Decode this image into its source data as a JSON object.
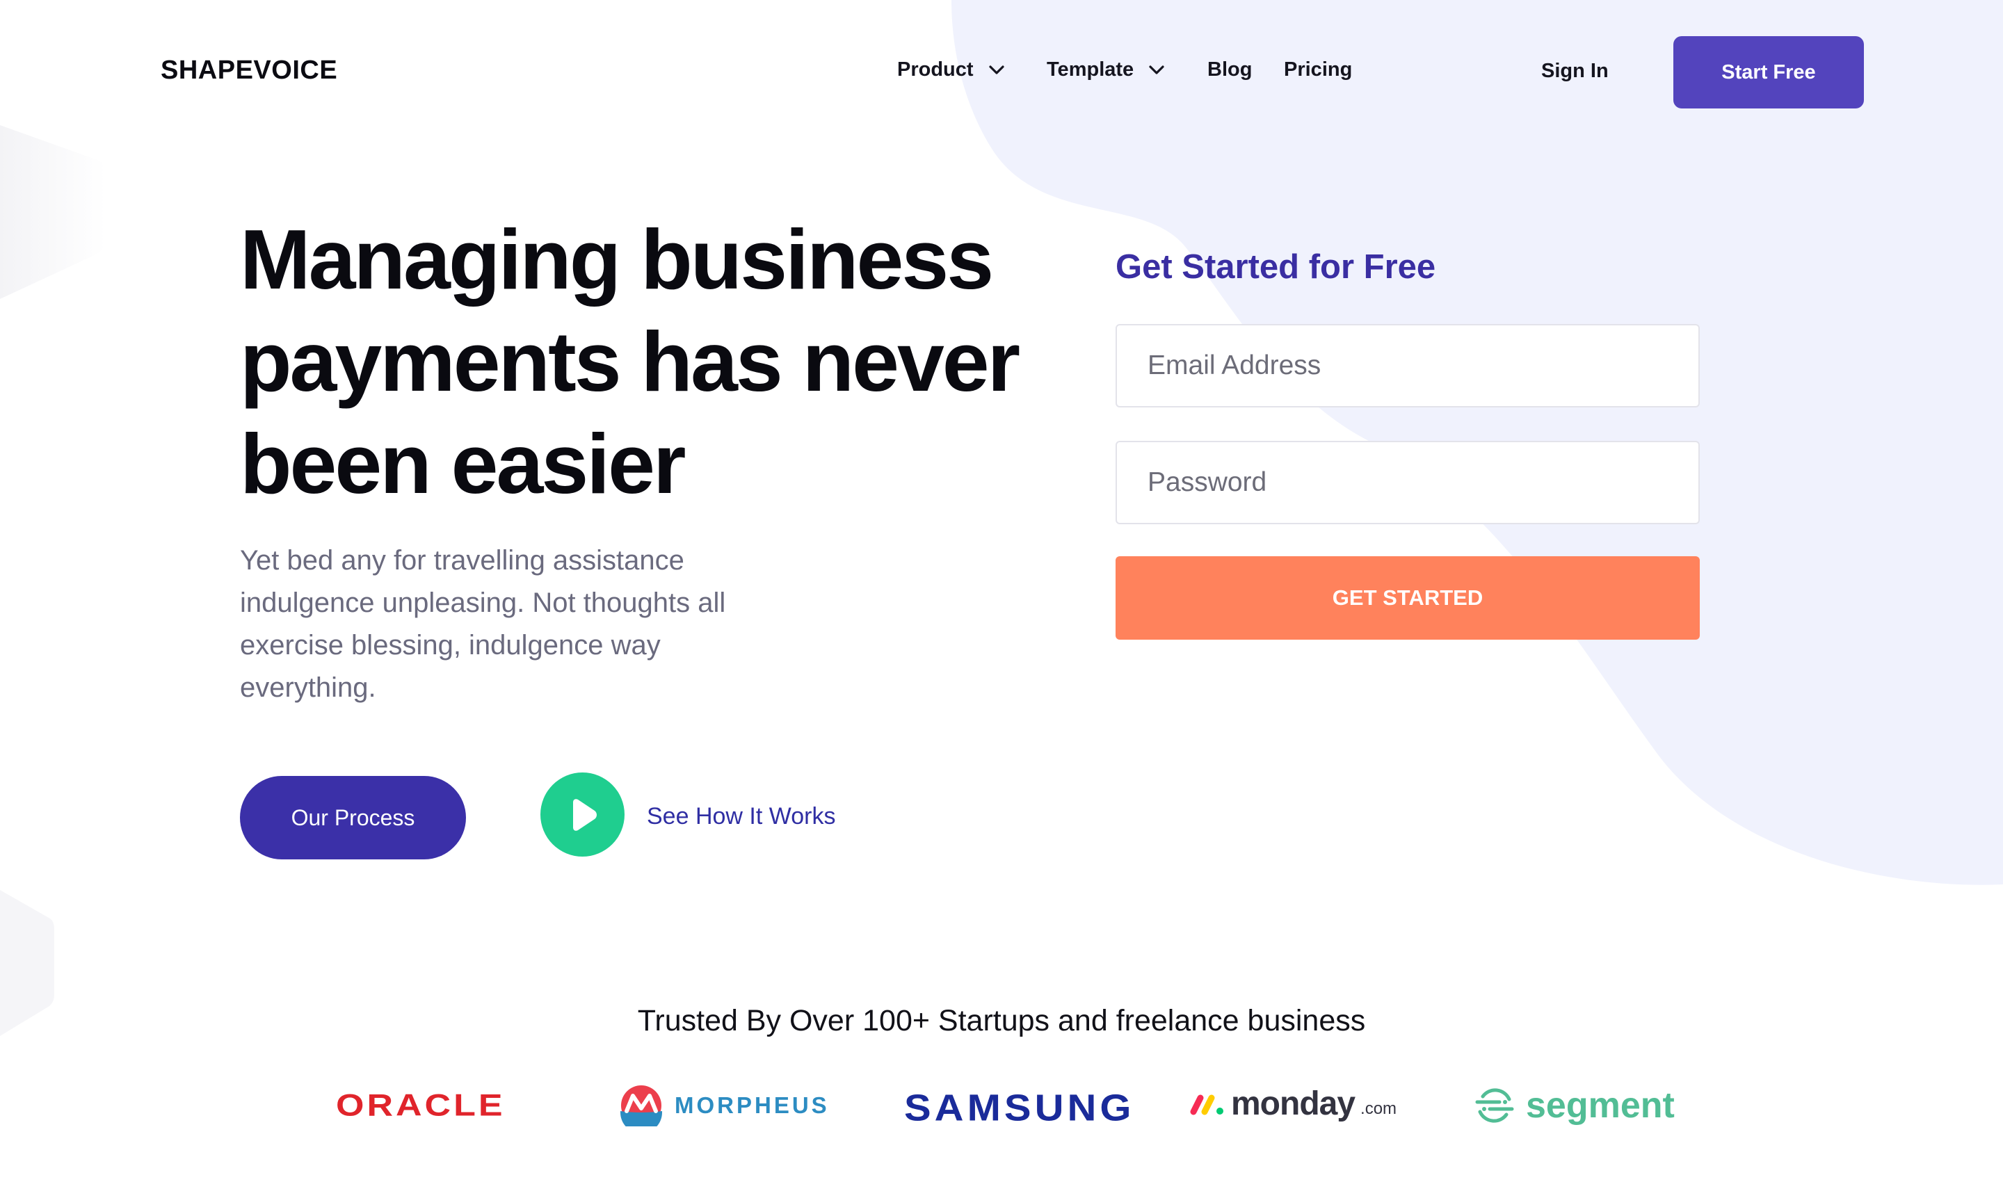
{
  "header": {
    "logo": "SHAPEVOICE",
    "nav": [
      {
        "label": "Product",
        "dropdown": true
      },
      {
        "label": "Template",
        "dropdown": true
      },
      {
        "label": "Blog",
        "dropdown": false
      },
      {
        "label": "Pricing",
        "dropdown": false
      }
    ],
    "sign_in": "Sign In",
    "start_free": "Start Free"
  },
  "hero": {
    "title_lines": [
      "Managing business",
      "payments has never",
      "been easier"
    ],
    "description": "Yet bed any for travelling assistance indulgence unpleasing. Not thoughts all exercise blessing, indulgence way everything.",
    "primary_button": "Our Process",
    "video_link": "See How It Works",
    "play_icon": "play-icon"
  },
  "signup": {
    "title": "Get Started for Free",
    "email_placeholder": "Email Address",
    "email_value": "",
    "password_placeholder": "Password",
    "password_value": "",
    "submit": "GET STARTED"
  },
  "trusted": {
    "heading": "Trusted By Over 100+ Startups and freelance business",
    "brands": [
      {
        "name": "ORACLE",
        "color": "#e0242b"
      },
      {
        "name": "MORPHEUS",
        "color": "#2c8cc2"
      },
      {
        "name": "SAMSUNG",
        "color": "#1a2b9a"
      },
      {
        "name": "monday",
        "suffix": ".com",
        "color": "#333340"
      },
      {
        "name": "segment",
        "color": "#52bd95"
      }
    ]
  },
  "colors": {
    "brand_purple": "#5344bd",
    "dark_purple": "#3b30a8",
    "cta_orange": "#ff825c",
    "play_green": "#1fce8f",
    "blob_lavender": "#f0f2fd"
  }
}
